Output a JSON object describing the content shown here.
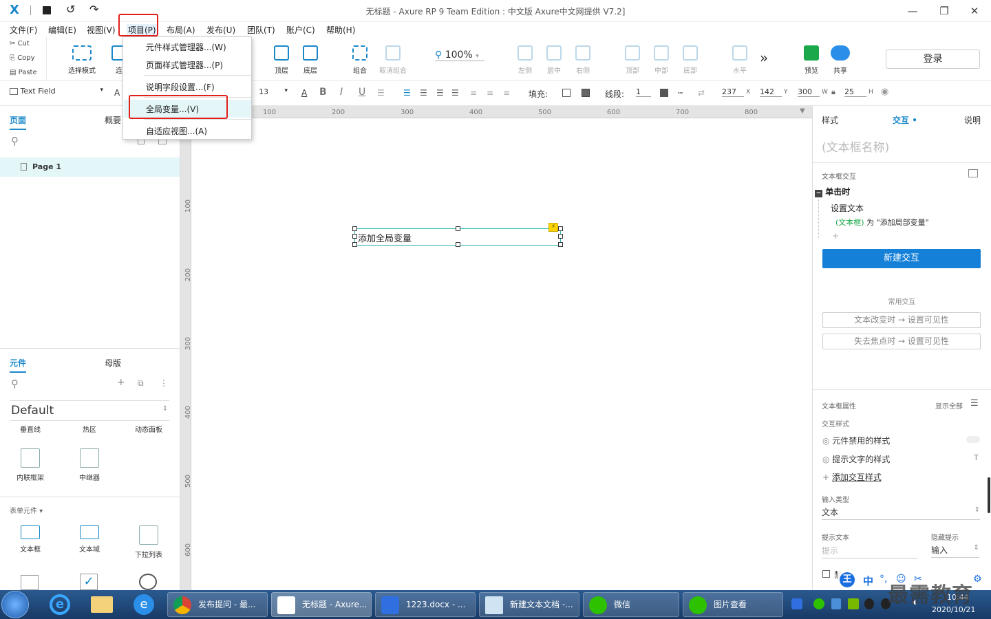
{
  "titlebar": {
    "title": "无标题 - Axure RP 9 Team Edition : 中文版   Axure中文网提供 V7.2]",
    "logo": "X"
  },
  "menu": [
    "文件(F)",
    "编辑(E)",
    "视图(V)",
    "项目(P)",
    "布局(A)",
    "发布(U)",
    "团队(T)",
    "账户(C)",
    "帮助(H)"
  ],
  "dropdown": [
    "元件样式管理器...(W)",
    "页面样式管理器...(P)",
    "说明字段设置...(F)",
    "全局变量...(V)",
    "自适应视图...(A)"
  ],
  "clipboard": {
    "cut": "Cut",
    "copy": "Copy",
    "paste": "Paste"
  },
  "toolbar": {
    "select_mode": "选择模式",
    "connect": "连",
    "top": "顶层",
    "bottom": "底层",
    "group": "组合",
    "ungroup": "取消组合",
    "zoom": "100%",
    "left": "左侧",
    "center": "居中",
    "right": "右侧",
    "top_align": "顶部",
    "middle": "中部",
    "bottom_align": "底部",
    "horizontal": "水平",
    "more": "»",
    "preview": "预览",
    "share": "共享",
    "login": "登录"
  },
  "format": {
    "widget_type": "Text Field",
    "font_stub": "A",
    "font_size": "13",
    "fill_label": "填充:",
    "line_label": "线段:",
    "line_value": "1",
    "x": "237",
    "x_label": "X",
    "y": "142",
    "y_label": "Y",
    "w": "300",
    "w_label": "W",
    "h": "25",
    "h_label": "H"
  },
  "left": {
    "tab_pages": "页面",
    "tab_outline": "概要",
    "page1": "Page 1",
    "tab_widgets": "元件",
    "tab_masters": "母版",
    "library": "Default",
    "row1": [
      "垂直线",
      "热区",
      "动态面板"
    ],
    "row2": [
      "内联框架",
      "中继器"
    ],
    "form_section": "表单元件 ▾",
    "row3": [
      "文本框",
      "文本域",
      "下拉列表"
    ]
  },
  "canvas": {
    "ruler_top": [
      "100",
      "200",
      "300",
      "400",
      "500",
      "600",
      "700",
      "800"
    ],
    "ruler_left": [
      "100",
      "200",
      "300",
      "400",
      "500",
      "600"
    ],
    "textbox_text": "添加全局变量"
  },
  "right": {
    "tab_style": "样式",
    "tab_interact": "交互",
    "tab_notes": "说明",
    "name_placeholder": "(文本框名称)",
    "section_interact": "文本框交互",
    "event": "单击时",
    "action": "设置文本",
    "action_detail_target": "(文本框)",
    "action_detail_rest": " 为 \"添加局部变量\"",
    "plus": "+",
    "new_interaction": "新建交互",
    "common": "常用交互",
    "common1": "文本改变时 → 设置可见性",
    "common2": "失去焦点时 → 设置可见性",
    "props": "文本框属性",
    "show_all": "显示全部",
    "interact_style": "交互样式",
    "disabled_style": "元件禁用的样式",
    "hint_style": "提示文字的样式",
    "add_style": "添加交互样式",
    "input_type_label": "输入类型",
    "input_type": "文本",
    "hint_text_label": "提示文本",
    "hint_text_placeholder": "提示",
    "hide_hint_label": "隐藏提示",
    "hide_hint": "输入",
    "disable_label": "禁"
  },
  "taskbar": {
    "tasks": [
      "发布提问 - 最...",
      "无标题 - Axure...",
      "1223.docx - ...",
      "新建文本文档 -...",
      "微信",
      "图片查看"
    ],
    "ime": "中",
    "date": "2020/10/21",
    "time": "10:44",
    "watermark": "最需教育"
  },
  "colors": {
    "accent": "#1a88c9",
    "button": "#1580d8",
    "highlight": "#e0201b"
  }
}
